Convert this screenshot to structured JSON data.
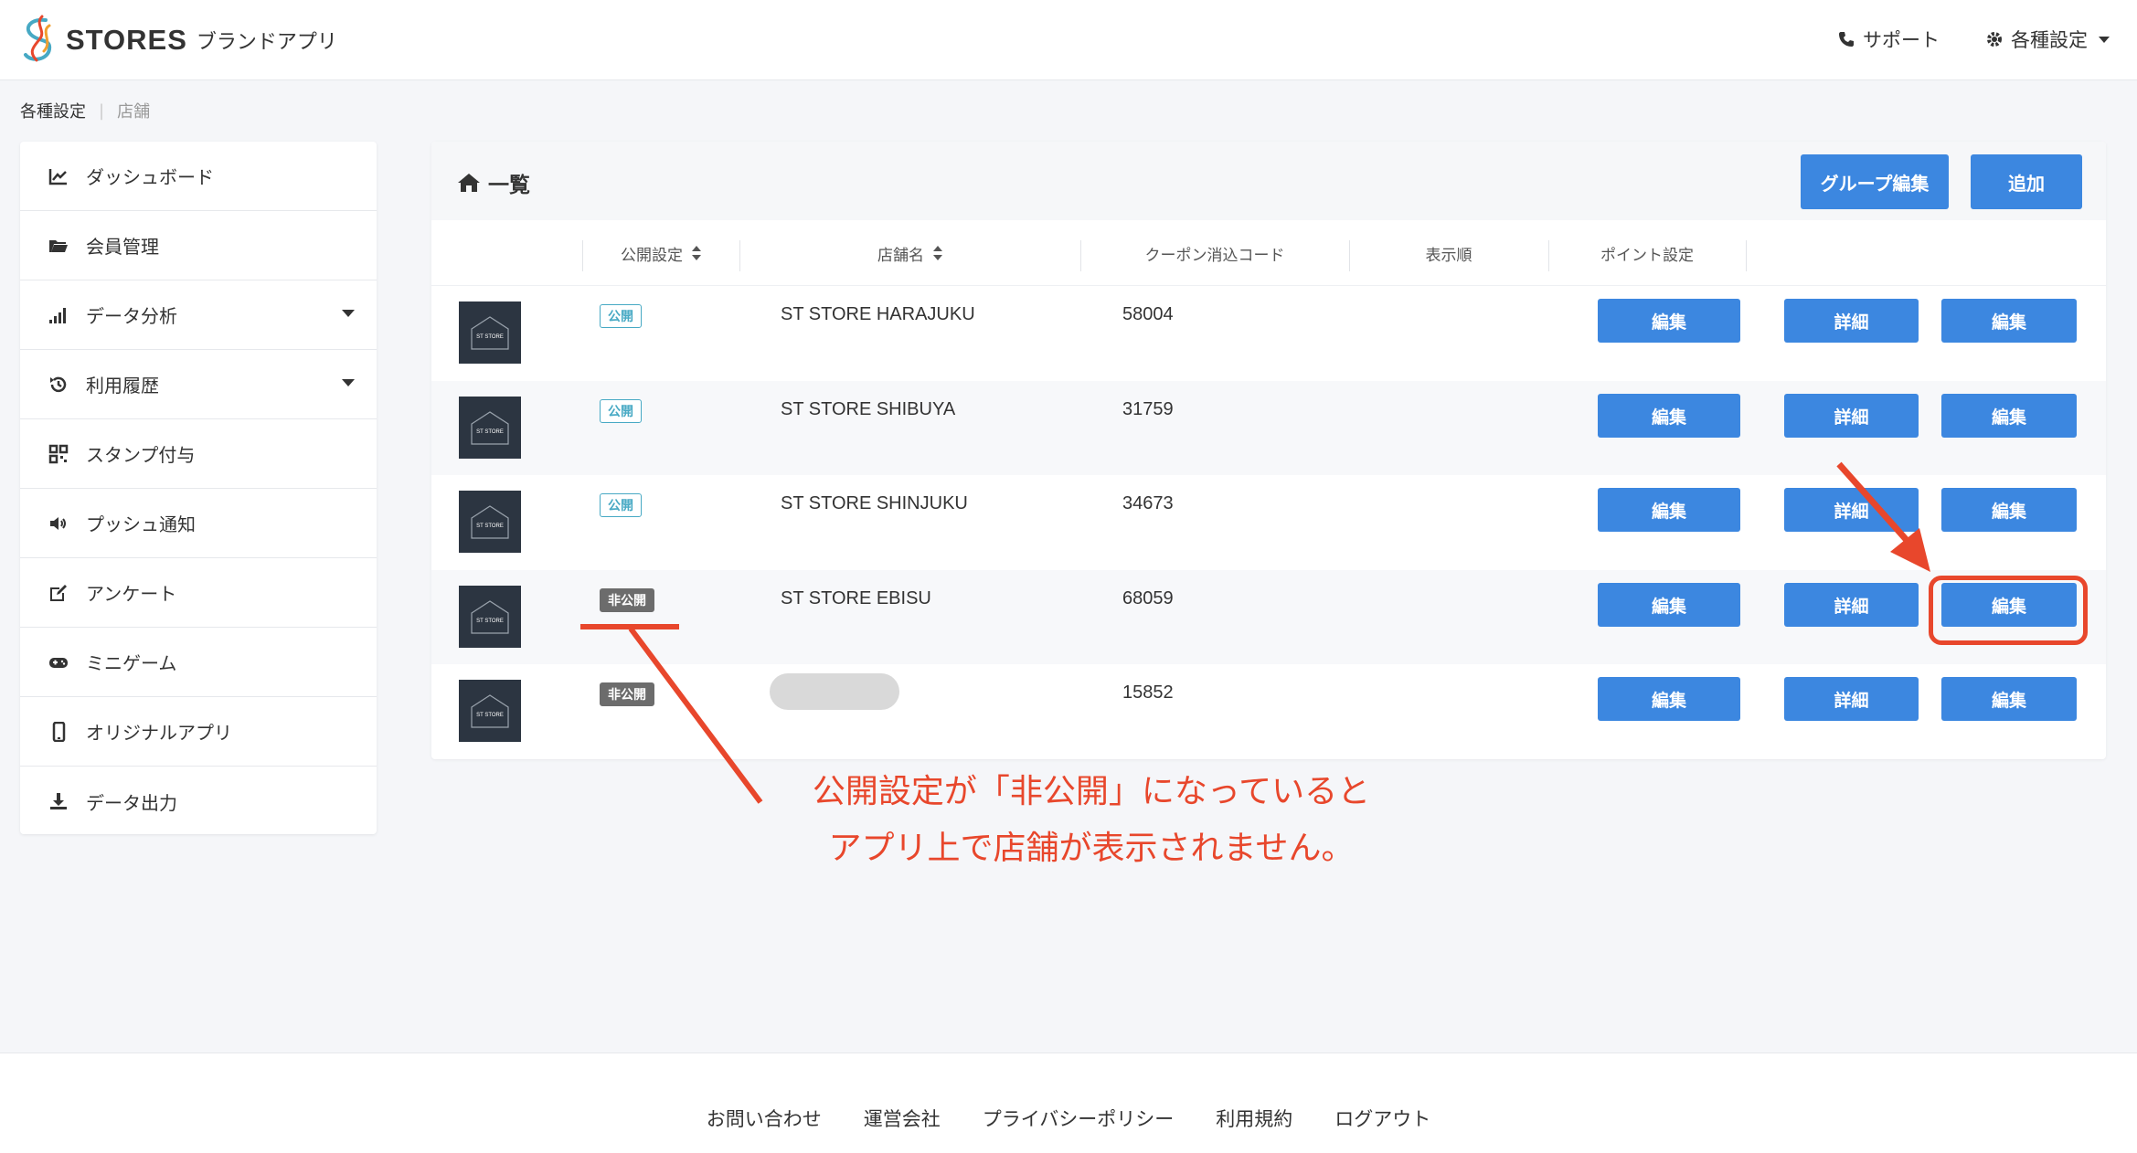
{
  "header": {
    "brand": "STORES",
    "brand_sub": "ブランドアプリ",
    "support": "サポート",
    "settings": "各種設定"
  },
  "breadcrumb": {
    "parent": "各種設定",
    "current": "店舗"
  },
  "sidebar": {
    "items": [
      {
        "label": "ダッシュボード",
        "icon": "line-chart-icon"
      },
      {
        "label": "会員管理",
        "icon": "folder-icon"
      },
      {
        "label": "データ分析",
        "icon": "signal-bars-icon"
      },
      {
        "label": "利用履歴",
        "icon": "history-icon"
      },
      {
        "label": "スタンプ付与",
        "icon": "qr-code-icon"
      },
      {
        "label": "プッシュ通知",
        "icon": "speaker-icon"
      },
      {
        "label": "アンケート",
        "icon": "edit-icon"
      },
      {
        "label": "ミニゲーム",
        "icon": "gamepad-icon"
      },
      {
        "label": "オリジナルアプリ",
        "icon": "mobile-icon"
      },
      {
        "label": "データ出力",
        "icon": "download-icon"
      }
    ]
  },
  "card": {
    "title": "一覧",
    "group_edit": "グループ編集",
    "add": "追加"
  },
  "table": {
    "headers": {
      "publish": "公開設定",
      "store_name": "店舗名",
      "coupon_code": "クーポン消込コード",
      "display_order": "表示順",
      "point": "ポイント設定"
    },
    "rows": [
      {
        "status": "公開",
        "name": "ST STORE HARAJUKU",
        "code": "58004",
        "b1": "編集",
        "b2": "詳細",
        "b3": "編集"
      },
      {
        "status": "公開",
        "name": "ST STORE SHIBUYA",
        "code": "31759",
        "b1": "編集",
        "b2": "詳細",
        "b3": "編集"
      },
      {
        "status": "公開",
        "name": "ST STORE SHINJUKU",
        "code": "34673",
        "b1": "編集",
        "b2": "詳細",
        "b3": "編集"
      },
      {
        "status": "非公開",
        "name": "ST STORE EBISU",
        "code": "68059",
        "b1": "編集",
        "b2": "詳細",
        "b3": "編集"
      },
      {
        "status": "非公開",
        "name": "",
        "code": "15852",
        "b1": "編集",
        "b2": "詳細",
        "b3": "編集"
      }
    ],
    "thumb_text": "ST STORE"
  },
  "annotation": {
    "line1": "公開設定が「非公開」になっていると",
    "line2": "アプリ上で店舗が表示されません。",
    "color": "#e8472c"
  },
  "footer": {
    "links": [
      "お問い合わせ",
      "運営会社",
      "プライバシーポリシー",
      "利用規約",
      "ログアウト"
    ]
  }
}
